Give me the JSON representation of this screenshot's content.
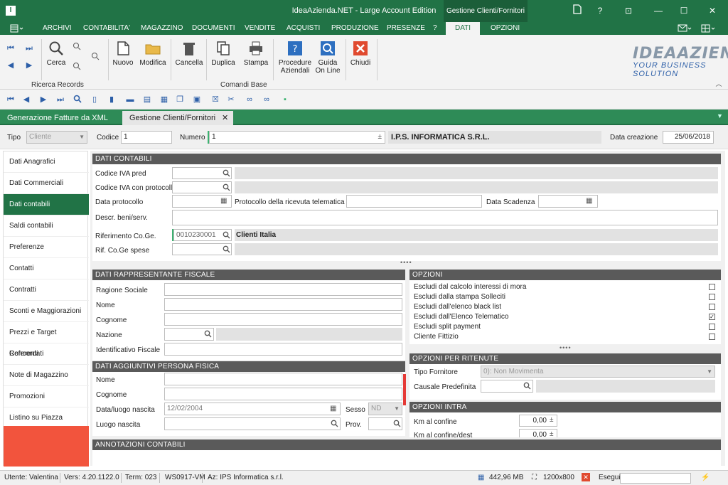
{
  "app": {
    "title": "IdeaAzienda.NET - Large Account Edition",
    "context_tab": "Gestione Clienti/Fornitori",
    "icon_letter": "I"
  },
  "window_controls": {
    "minimize": "—",
    "maximize": "☐",
    "close": "✕",
    "help": "?",
    "restore": "⊡"
  },
  "menu": {
    "items": [
      "ARCHIVI",
      "CONTABILITA'",
      "MAGAZZINO",
      "DOCUMENTI",
      "VENDITE",
      "ACQUISTI",
      "PRODUZIONE",
      "PRESENZE",
      "?",
      "DATI",
      "OPZIONI"
    ],
    "active": "DATI"
  },
  "ribbon": {
    "ricerca": {
      "cerca": "Cerca",
      "group": "Ricerca Records"
    },
    "comandi": {
      "nuovo": "Nuovo",
      "modifica": "Modifica",
      "cancella": "Cancella",
      "duplica": "Duplica",
      "stampa": "Stampa",
      "procedure": "Procedure Aziendali",
      "guida": "Guida On Line",
      "chiudi": "Chiudi",
      "group": "Comandi Base"
    },
    "logo_line1": "IDEAAZIENDA",
    "logo_line2": "YOUR BUSINESS SOLUTION"
  },
  "doc_tabs": [
    {
      "label": "Generazione Fatture da XML"
    },
    {
      "label": "Gestione Clienti/Fornitori",
      "close": "✕"
    }
  ],
  "header": {
    "tipo_label": "Tipo",
    "tipo_value": "Cliente",
    "codice_label": "Codice",
    "codice_value": "1",
    "numero_label": "Numero",
    "numero_value": "1",
    "ragione": "I.P.S. INFORMATICA S.R.L.",
    "data_label": "Data creazione",
    "data_value": "25/06/2018"
  },
  "sidebar": [
    "Dati Anagrafici",
    "Dati Commerciali",
    "Dati contabili",
    "Saldi contabili",
    "Preferenze",
    "Contatti",
    "Contratti",
    "Sconti e Maggiorazioni",
    "Prezzi e Target Concordati",
    "Referenti",
    "Note di Magazzino",
    "Promozioni",
    "Listino su Piazza"
  ],
  "sidebar_active": "Dati contabili",
  "dati_contabili": {
    "title": "DATI CONTABILI",
    "codice_iva_pred": "Codice IVA pred",
    "codice_iva_prot": "Codice IVA con protocollo",
    "data_protocollo": "Data protocollo",
    "protocollo_ricevuta": "Protocollo della ricevuta telematica",
    "data_scadenza": "Data Scadenza",
    "descr_beni": "Descr. beni/serv.",
    "rif_coge": "Riferimento Co.Ge.",
    "rif_coge_value": "0010230001",
    "rif_coge_desc": "Clienti Italia",
    "rif_coge_spese": "Rif. Co.Ge spese"
  },
  "rappresentante": {
    "title": "DATI RAPPRESENTANTE FISCALE",
    "ragione_sociale": "Ragione Sociale",
    "nome": "Nome",
    "cognome": "Cognome",
    "nazione": "Nazione",
    "identificativo": "Identificativo Fiscale"
  },
  "persona_fisica": {
    "title": "DATI AGGIUNTIVI PERSONA FISICA",
    "nome": "Nome",
    "cognome": "Cognome",
    "data_luogo": "Data/luogo nascita",
    "data_value": "12/02/2004",
    "sesso": "Sesso",
    "sesso_value": "ND",
    "luogo": "Luogo nascita",
    "prov": "Prov."
  },
  "opzioni": {
    "title": "OPZIONI",
    "items": [
      {
        "label": "Escludi dal calcolo interessi di mora",
        "checked": false
      },
      {
        "label": "Escludi dalla stampa Solleciti",
        "checked": false
      },
      {
        "label": "Escludi dall'elenco black list",
        "checked": false
      },
      {
        "label": "Escludi dall'Elenco Telematico",
        "checked": true
      },
      {
        "label": "Escludi split payment",
        "checked": false
      },
      {
        "label": "Cliente Fittizio",
        "checked": false
      }
    ]
  },
  "ritenute": {
    "title": "OPZIONI PER RITENUTE",
    "tipo_fornitore": "Tipo Fornitore",
    "tipo_value": "0): Non Movimenta",
    "causale": "Causale Predefinita"
  },
  "intra": {
    "title": "OPZIONI INTRA",
    "km_confine": "Km al confine",
    "km_confine_value": "0,00",
    "km_dest": "Km al confine/dest",
    "km_dest_value": "0,00"
  },
  "annotazioni": {
    "title": "ANNOTAZIONI CONTABILI"
  },
  "status": {
    "utente": "Utente: Valentina",
    "vers": "Vers: 4.20.1122.0",
    "term": "Term: 023",
    "ws": "WS0917-VM",
    "az": "Az: IPS Informatica s.r.l.",
    "mem": "442,96 MB",
    "res": "1200x800",
    "esegui": "Esegui"
  },
  "colors": {
    "accent": "#217346",
    "sidebar_bottom": "#f2543d",
    "section_header": "#5a5a5a"
  }
}
